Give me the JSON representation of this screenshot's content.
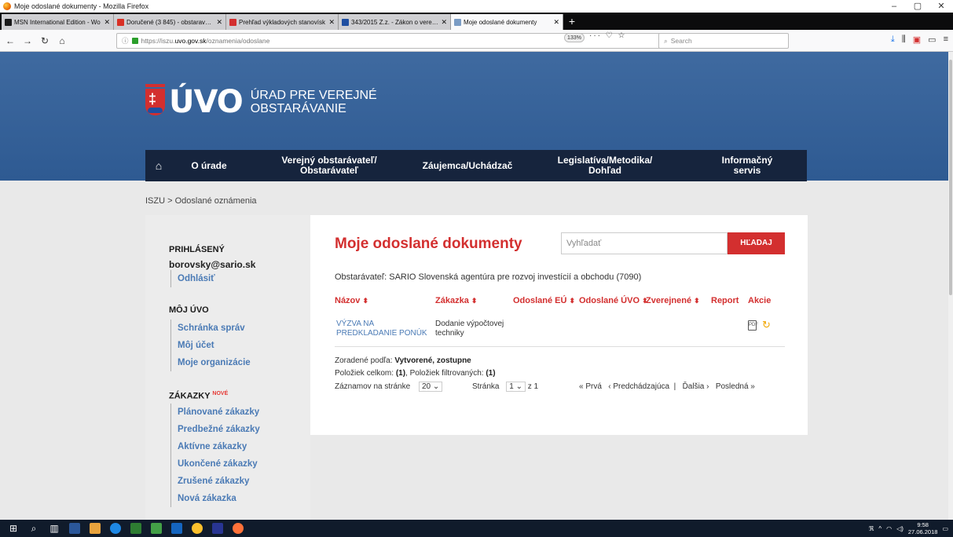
{
  "window": {
    "title": "Moje odoslané dokumenty - Mozilla Firefox",
    "minimize": "–",
    "maximize": "▢",
    "close": "✕"
  },
  "tabs": [
    {
      "label": "MSN International Edition - Wo",
      "icon_color": "#1a1a1a"
    },
    {
      "label": "Doručené (3 845) - obstaravatel",
      "icon_color": "#d93025"
    },
    {
      "label": "Prehľad výkladových stanovísk",
      "icon_color": "#d32f2f"
    },
    {
      "label": "343/2015 Z.z. - Zákon o verejno",
      "icon_color": "#1f4fa1"
    },
    {
      "label": "Moje odoslané dokumenty",
      "icon_color": "#7a9cc4",
      "active": true
    }
  ],
  "browser": {
    "url_prefix": "https://iszu.",
    "url_domain": "uvo.gov.sk",
    "url_path": "/oznamenia/odoslane",
    "zoom": "133%",
    "search_placeholder": "Search",
    "url_icons": "··· ♡ ☆",
    "new_tab": "+"
  },
  "site": {
    "logo_text": "ÚVO",
    "logo_line1": "ÚRAD PRE VEREJNÉ",
    "logo_line2": "OBSTARÁVANIE",
    "nav": [
      {
        "label": "O úrade"
      },
      {
        "label": "Verejný obstarávateľ/ Obstarávateľ"
      },
      {
        "label": "Záujemca/Uchádzač"
      },
      {
        "label": "Legislatíva/Metodika/ Dohľad"
      },
      {
        "label": "Informačný servis"
      }
    ],
    "breadcrumb": "ISZU  >  Odoslané oznámenia"
  },
  "sidebar": {
    "logged_in_heading": "PRIHLÁSENÝ",
    "user": "borovsky@sario.sk",
    "logout": "Odhlásiť",
    "my_uvo_heading": "MÔJ ÚVO",
    "my_uvo_items": [
      "Schránka správ",
      "Môj účet",
      "Moje organizácie"
    ],
    "contracts_heading": "ZÁKAZKY",
    "new_badge": "NOVÉ",
    "contracts_items": [
      "Plánované zákazky",
      "Predbežné zákazky",
      "Aktívne zákazky",
      "Ukončené zákazky",
      "Zrušené zákazky",
      "Nová zákazka"
    ]
  },
  "main": {
    "title": "Moje odoslané dokumenty",
    "search_placeholder": "Vyhľadať",
    "search_button": "HĽADAJ",
    "contractor": "Obstarávateľ: SARIO Slovenská agentúra pre rozvoj investícií a obchodu (7090)",
    "columns": [
      "Názov",
      "Zákazka",
      "Odoslané EÚ",
      "Odoslané ÚVO",
      "Zverejnené",
      "Report",
      "Akcie"
    ],
    "rows": [
      {
        "name": "VÝZVA NA PREDKLADANIE PONÚK",
        "contract": "Dodanie výpočtovej techniky"
      }
    ],
    "sorted_by_label": "Zoradené podľa:",
    "sorted_by_value": "Vytvorené, zostupne",
    "items_label": "Položiek celkom:",
    "items_total": "(1)",
    "filtered_label": ", Položiek filtrovaných:",
    "items_filtered": "(1)",
    "per_page_label": "Záznamov na stránke",
    "per_page_value": "20",
    "page_label": "Stránka",
    "page_value": "1",
    "page_of": "z 1",
    "first": "« Prvá",
    "prev": "‹ Predchádzajúca",
    "next": "Ďalšia ›",
    "last": "Posledná »"
  },
  "taskbar": {
    "time": "9:58",
    "date": "27.06.2018"
  }
}
